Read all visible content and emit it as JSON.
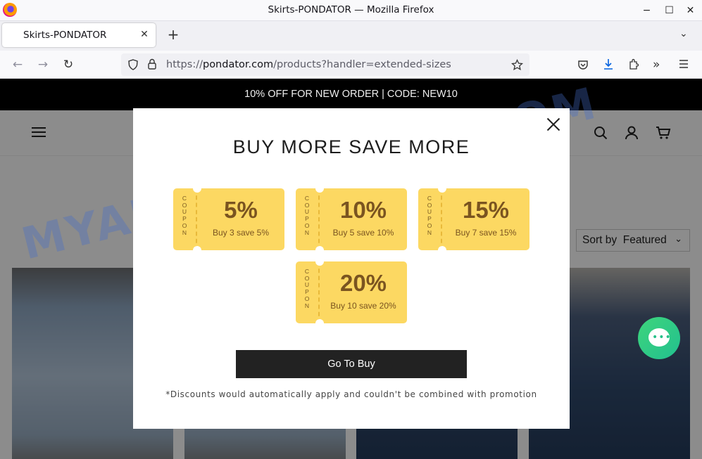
{
  "window": {
    "title": "Skirts-PONDATOR — Mozilla Firefox",
    "minimize": "−",
    "maximize": "☐",
    "close": "✕"
  },
  "tabs": {
    "active_label": "Skirts-PONDATOR",
    "close_glyph": "✕",
    "new_tab_glyph": "+",
    "list_glyph": "⌄"
  },
  "navbar": {
    "url_prefix": "https://",
    "url_host": "pondator.com",
    "url_path": "/products?handler=extended-sizes",
    "back": "←",
    "forward": "→",
    "reload": "↻"
  },
  "site": {
    "announcement": "10% OFF FOR NEW ORDER | CODE: NEW10",
    "sort_label": "Sort by",
    "sort_value": "Featured"
  },
  "watermark": "MYANTISPYWARE.COM",
  "modal": {
    "heading": "BUY MORE SAVE MORE",
    "coupons": [
      {
        "stub": "COUPON",
        "percent": "5%",
        "desc": "Buy 3 save 5%"
      },
      {
        "stub": "COUPON",
        "percent": "10%",
        "desc": "Buy 5 save 10%"
      },
      {
        "stub": "COUPON",
        "percent": "15%",
        "desc": "Buy 7 save 15%"
      },
      {
        "stub": "COUPON",
        "percent": "20%",
        "desc": "Buy 10 save 20%"
      }
    ],
    "button": "Go To Buy",
    "note": "*Discounts would automatically apply and couldn't be combined with promotion"
  },
  "colors": {
    "coupon": "#fcd862",
    "coupon_text": "#7a5420",
    "button": "#222222",
    "chat": "#2fcb84"
  }
}
